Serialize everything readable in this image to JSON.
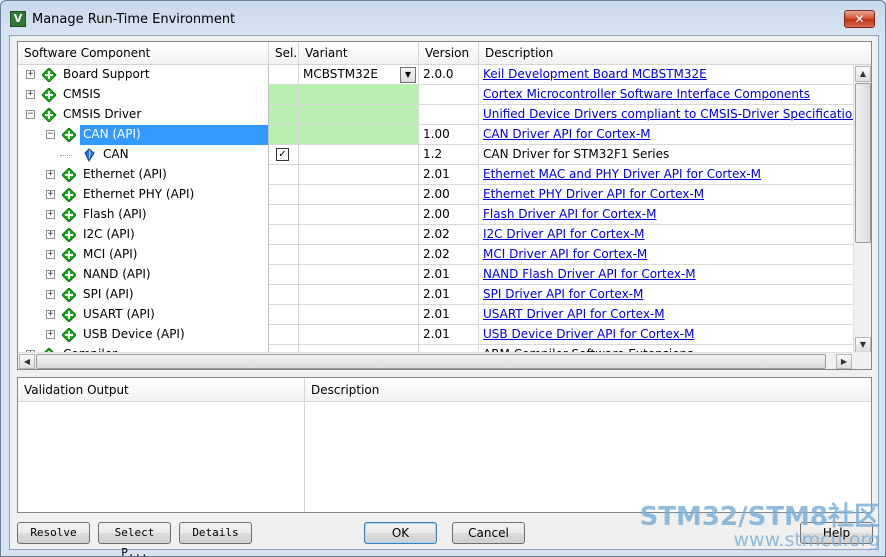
{
  "window": {
    "title": "Manage Run-Time Environment",
    "icon_glyph": "V",
    "close_glyph": "✕"
  },
  "columns": {
    "component": "Software Component",
    "sel": "Sel.",
    "variant": "Variant",
    "version": "Version",
    "description": "Description"
  },
  "rows": [
    {
      "name": "Board Support",
      "level": 0,
      "expander": "+",
      "icon": "green-diamond-icon",
      "sel": "",
      "variant": "MCBSTM32E",
      "has_dropdown": true,
      "version": "2.0.0",
      "description": "Keil Development Board MCBSTM32E",
      "link": true,
      "green": false,
      "selected": false
    },
    {
      "name": "CMSIS",
      "level": 0,
      "expander": "+",
      "icon": "green-diamond-icon",
      "sel": "",
      "variant": "",
      "version": "",
      "description": "Cortex Microcontroller Software Interface Components",
      "link": true,
      "green": true,
      "selected": false
    },
    {
      "name": "CMSIS Driver",
      "level": 0,
      "expander": "−",
      "icon": "green-diamond-icon",
      "sel": "",
      "variant": "",
      "version": "",
      "description": "Unified Device Drivers compliant to CMSIS-Driver Specifications",
      "link": true,
      "green": true,
      "selected": false
    },
    {
      "name": "CAN (API)",
      "level": 1,
      "expander": "−",
      "icon": "green-diamond-icon",
      "sel": "",
      "variant": "",
      "version": "1.00",
      "description": "CAN Driver API for Cortex-M",
      "link": true,
      "green": true,
      "selected": true
    },
    {
      "name": "CAN",
      "level": 2,
      "expander": "",
      "icon": "blue-gem-icon",
      "sel": "✓",
      "variant": "",
      "version": "1.2",
      "description": "CAN Driver for STM32F1 Series",
      "link": false,
      "green": false,
      "selected": false
    },
    {
      "name": "Ethernet (API)",
      "level": 1,
      "expander": "+",
      "icon": "green-diamond-icon",
      "sel": "",
      "variant": "",
      "version": "2.01",
      "description": "Ethernet MAC and PHY Driver API for Cortex-M",
      "link": true,
      "green": false,
      "selected": false
    },
    {
      "name": "Ethernet PHY (API)",
      "level": 1,
      "expander": "+",
      "icon": "green-diamond-icon",
      "sel": "",
      "variant": "",
      "version": "2.00",
      "description": "Ethernet PHY Driver API for Cortex-M",
      "link": true,
      "green": false,
      "selected": false
    },
    {
      "name": "Flash (API)",
      "level": 1,
      "expander": "+",
      "icon": "green-diamond-icon",
      "sel": "",
      "variant": "",
      "version": "2.00",
      "description": "Flash Driver API for Cortex-M",
      "link": true,
      "green": false,
      "selected": false
    },
    {
      "name": "I2C (API)",
      "level": 1,
      "expander": "+",
      "icon": "green-diamond-icon",
      "sel": "",
      "variant": "",
      "version": "2.02",
      "description": "I2C Driver API for Cortex-M",
      "link": true,
      "green": false,
      "selected": false
    },
    {
      "name": "MCI (API)",
      "level": 1,
      "expander": "+",
      "icon": "green-diamond-icon",
      "sel": "",
      "variant": "",
      "version": "2.02",
      "description": "MCI Driver API for Cortex-M",
      "link": true,
      "green": false,
      "selected": false
    },
    {
      "name": "NAND (API)",
      "level": 1,
      "expander": "+",
      "icon": "green-diamond-icon",
      "sel": "",
      "variant": "",
      "version": "2.01",
      "description": "NAND Flash Driver API for Cortex-M",
      "link": true,
      "green": false,
      "selected": false
    },
    {
      "name": "SPI (API)",
      "level": 1,
      "expander": "+",
      "icon": "green-diamond-icon",
      "sel": "",
      "variant": "",
      "version": "2.01",
      "description": "SPI Driver API for Cortex-M",
      "link": true,
      "green": false,
      "selected": false
    },
    {
      "name": "USART (API)",
      "level": 1,
      "expander": "+",
      "icon": "green-diamond-icon",
      "sel": "",
      "variant": "",
      "version": "2.01",
      "description": "USART Driver API for Cortex-M",
      "link": true,
      "green": false,
      "selected": false
    },
    {
      "name": "USB Device (API)",
      "level": 1,
      "expander": "+",
      "icon": "green-diamond-icon",
      "sel": "",
      "variant": "",
      "version": "2.01",
      "description": "USB Device Driver API for Cortex-M",
      "link": true,
      "green": false,
      "selected": false
    },
    {
      "name": "Compiler",
      "level": 0,
      "expander": "+",
      "icon": "green-diamond-icon",
      "sel": "",
      "variant": "",
      "version": "",
      "description": "ARM Compiler Software Extensions",
      "link": false,
      "green": false,
      "selected": false
    }
  ],
  "validation": {
    "output_header": "Validation Output",
    "description_header": "Description"
  },
  "buttons": {
    "resolve": "Resolve",
    "select_packs": "Select P...",
    "details": "Details",
    "ok": "OK",
    "cancel": "Cancel",
    "help": "Help"
  },
  "scroll": {
    "up": "▲",
    "down": "▼",
    "left": "◀",
    "right": "▶",
    "dropdown": "▼"
  },
  "watermark": {
    "line1": "STM32/STM8社区",
    "line2": "www.stmcu.org"
  },
  "colors": {
    "selection": "#3399ff",
    "link": "#0000cc",
    "green_sel": "#b8f0b0",
    "diamond": "#1fae1f"
  }
}
